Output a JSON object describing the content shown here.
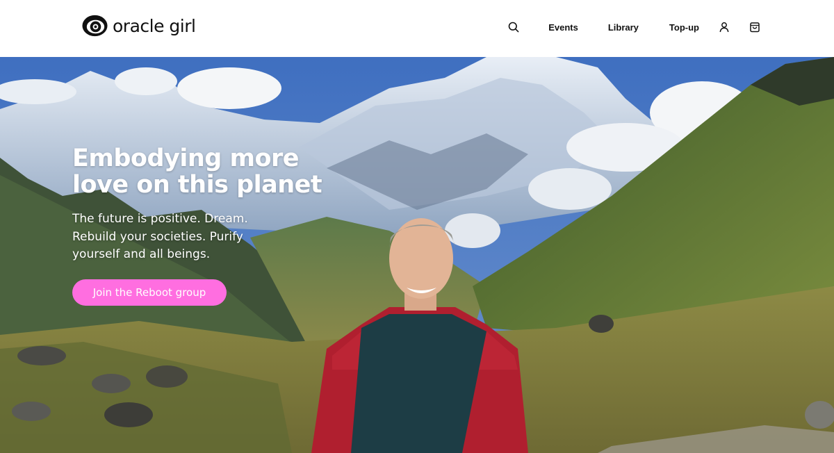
{
  "header": {
    "logo": {
      "text": "oracle girl",
      "icon": "eye-icon"
    },
    "nav": {
      "search_icon": "search-icon",
      "links": [
        "Events",
        "Library",
        "Top-up"
      ],
      "account_icon": "user-icon",
      "cart_icon": "shopping-bag-icon"
    }
  },
  "hero": {
    "title_line1": "Embodying more",
    "title_line2": "love on this planet",
    "subtitle": "The future is positive. Dream. Rebuild your societies. Purify yourself and all beings.",
    "cta_label": "Join the Reboot group",
    "cta_color": "#ff6ee0",
    "image": "Smiling person in red puffer jacket standing in a mountain valley with snowy peaks and clouds"
  }
}
